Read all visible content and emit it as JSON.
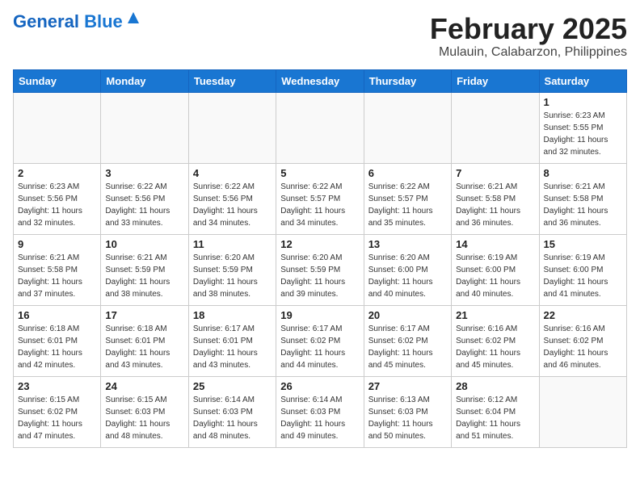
{
  "header": {
    "logo_general": "General",
    "logo_blue": "Blue",
    "month_title": "February 2025",
    "location": "Mulauin, Calabarzon, Philippines"
  },
  "weekdays": [
    "Sunday",
    "Monday",
    "Tuesday",
    "Wednesday",
    "Thursday",
    "Friday",
    "Saturday"
  ],
  "weeks": [
    [
      {
        "day": "",
        "sunrise": "",
        "sunset": "",
        "daylight": ""
      },
      {
        "day": "",
        "sunrise": "",
        "sunset": "",
        "daylight": ""
      },
      {
        "day": "",
        "sunrise": "",
        "sunset": "",
        "daylight": ""
      },
      {
        "day": "",
        "sunrise": "",
        "sunset": "",
        "daylight": ""
      },
      {
        "day": "",
        "sunrise": "",
        "sunset": "",
        "daylight": ""
      },
      {
        "day": "",
        "sunrise": "",
        "sunset": "",
        "daylight": ""
      },
      {
        "day": "1",
        "sunrise": "6:23 AM",
        "sunset": "5:55 PM",
        "daylight": "11 hours and 32 minutes."
      }
    ],
    [
      {
        "day": "2",
        "sunrise": "6:23 AM",
        "sunset": "5:56 PM",
        "daylight": "11 hours and 32 minutes."
      },
      {
        "day": "3",
        "sunrise": "6:22 AM",
        "sunset": "5:56 PM",
        "daylight": "11 hours and 33 minutes."
      },
      {
        "day": "4",
        "sunrise": "6:22 AM",
        "sunset": "5:56 PM",
        "daylight": "11 hours and 34 minutes."
      },
      {
        "day": "5",
        "sunrise": "6:22 AM",
        "sunset": "5:57 PM",
        "daylight": "11 hours and 34 minutes."
      },
      {
        "day": "6",
        "sunrise": "6:22 AM",
        "sunset": "5:57 PM",
        "daylight": "11 hours and 35 minutes."
      },
      {
        "day": "7",
        "sunrise": "6:21 AM",
        "sunset": "5:58 PM",
        "daylight": "11 hours and 36 minutes."
      },
      {
        "day": "8",
        "sunrise": "6:21 AM",
        "sunset": "5:58 PM",
        "daylight": "11 hours and 36 minutes."
      }
    ],
    [
      {
        "day": "9",
        "sunrise": "6:21 AM",
        "sunset": "5:58 PM",
        "daylight": "11 hours and 37 minutes."
      },
      {
        "day": "10",
        "sunrise": "6:21 AM",
        "sunset": "5:59 PM",
        "daylight": "11 hours and 38 minutes."
      },
      {
        "day": "11",
        "sunrise": "6:20 AM",
        "sunset": "5:59 PM",
        "daylight": "11 hours and 38 minutes."
      },
      {
        "day": "12",
        "sunrise": "6:20 AM",
        "sunset": "5:59 PM",
        "daylight": "11 hours and 39 minutes."
      },
      {
        "day": "13",
        "sunrise": "6:20 AM",
        "sunset": "6:00 PM",
        "daylight": "11 hours and 40 minutes."
      },
      {
        "day": "14",
        "sunrise": "6:19 AM",
        "sunset": "6:00 PM",
        "daylight": "11 hours and 40 minutes."
      },
      {
        "day": "15",
        "sunrise": "6:19 AM",
        "sunset": "6:00 PM",
        "daylight": "11 hours and 41 minutes."
      }
    ],
    [
      {
        "day": "16",
        "sunrise": "6:18 AM",
        "sunset": "6:01 PM",
        "daylight": "11 hours and 42 minutes."
      },
      {
        "day": "17",
        "sunrise": "6:18 AM",
        "sunset": "6:01 PM",
        "daylight": "11 hours and 43 minutes."
      },
      {
        "day": "18",
        "sunrise": "6:17 AM",
        "sunset": "6:01 PM",
        "daylight": "11 hours and 43 minutes."
      },
      {
        "day": "19",
        "sunrise": "6:17 AM",
        "sunset": "6:02 PM",
        "daylight": "11 hours and 44 minutes."
      },
      {
        "day": "20",
        "sunrise": "6:17 AM",
        "sunset": "6:02 PM",
        "daylight": "11 hours and 45 minutes."
      },
      {
        "day": "21",
        "sunrise": "6:16 AM",
        "sunset": "6:02 PM",
        "daylight": "11 hours and 45 minutes."
      },
      {
        "day": "22",
        "sunrise": "6:16 AM",
        "sunset": "6:02 PM",
        "daylight": "11 hours and 46 minutes."
      }
    ],
    [
      {
        "day": "23",
        "sunrise": "6:15 AM",
        "sunset": "6:02 PM",
        "daylight": "11 hours and 47 minutes."
      },
      {
        "day": "24",
        "sunrise": "6:15 AM",
        "sunset": "6:03 PM",
        "daylight": "11 hours and 48 minutes."
      },
      {
        "day": "25",
        "sunrise": "6:14 AM",
        "sunset": "6:03 PM",
        "daylight": "11 hours and 48 minutes."
      },
      {
        "day": "26",
        "sunrise": "6:14 AM",
        "sunset": "6:03 PM",
        "daylight": "11 hours and 49 minutes."
      },
      {
        "day": "27",
        "sunrise": "6:13 AM",
        "sunset": "6:03 PM",
        "daylight": "11 hours and 50 minutes."
      },
      {
        "day": "28",
        "sunrise": "6:12 AM",
        "sunset": "6:04 PM",
        "daylight": "11 hours and 51 minutes."
      },
      {
        "day": "",
        "sunrise": "",
        "sunset": "",
        "daylight": ""
      }
    ]
  ]
}
